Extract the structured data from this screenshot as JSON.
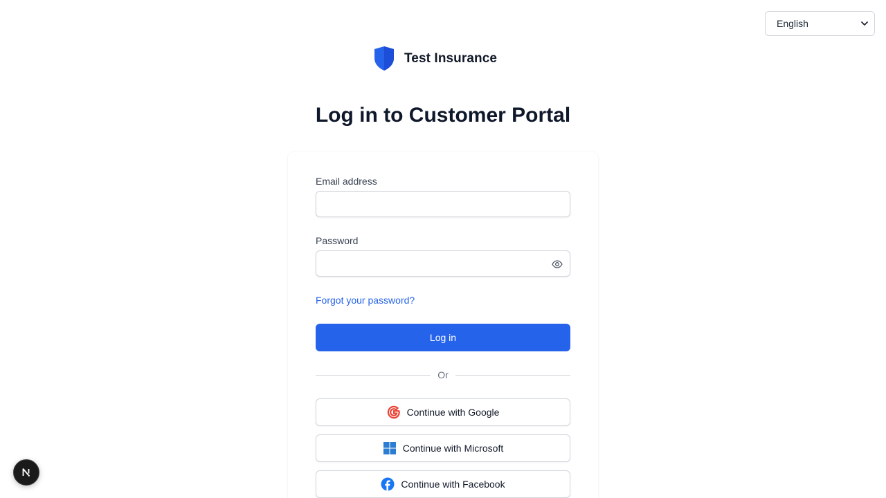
{
  "language": {
    "selected": "English"
  },
  "brand": {
    "name": "Test Insurance"
  },
  "page": {
    "title": "Log in to Customer Portal"
  },
  "form": {
    "email_label": "Email address",
    "email_value": "",
    "password_label": "Password",
    "password_value": "",
    "forgot_link": "Forgot your password?",
    "login_button": "Log in",
    "divider_text": "Or"
  },
  "social": {
    "google": "Continue with Google",
    "microsoft": "Continue with Microsoft",
    "facebook": "Continue with Facebook"
  },
  "colors": {
    "primary": "#2563eb",
    "heading": "#0f172a",
    "border": "#d1d5db"
  }
}
